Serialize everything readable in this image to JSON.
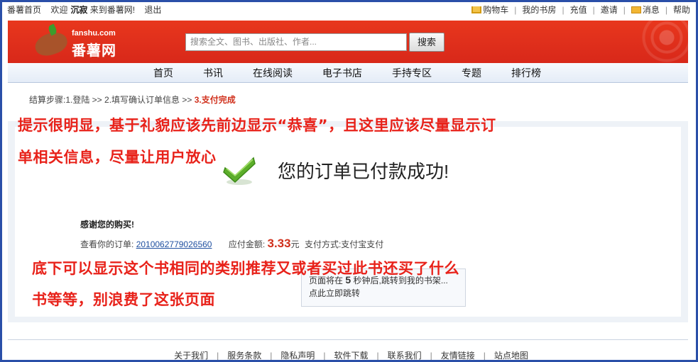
{
  "topbar": {
    "home": "番薯首页",
    "welcome_prefix": "欢迎",
    "username": "沉寂",
    "welcome_suffix": "来到番薯网!",
    "logout": "退出",
    "cart": "购物车",
    "my_books": "我的书房",
    "recharge": "充值",
    "invite": "邀请",
    "messages": "消息",
    "help": "帮助"
  },
  "header": {
    "logo_en": "fanshu.com",
    "logo_cn": "番薯网",
    "search_placeholder": "搜索全文、图书、出版社、作者...",
    "search_button": "搜索"
  },
  "nav": {
    "items": [
      "首页",
      "书讯",
      "在线阅读",
      "电子书店",
      "手持专区",
      "专题",
      "排行榜"
    ]
  },
  "steps": {
    "prefix": "结算步骤:1.登陆 >> 2.填写确认订单信息 >> ",
    "current": "3.支付完成"
  },
  "content": {
    "success_title": "您的订单已付款成功!",
    "thanks": "感谢您的购买!",
    "order_label": "查看你的订单:",
    "order_id": "2010062779026560",
    "amount_label": "应付金额:",
    "amount": "3.33",
    "amount_unit": "元",
    "payment_label": "支付方式:",
    "payment_method": "支付宝支付",
    "redirect_prefix": "页面将在",
    "redirect_seconds": "5",
    "redirect_suffix": "秒钟后,跳转到我的书架...",
    "redirect_link": "点此立即跳转"
  },
  "annotations": {
    "top_line1": "提示很明显，基于礼貌应该先前边显示“恭喜”，且这里应该尽量显示订",
    "top_line2": "单相关信息，尽量让用户放心",
    "bottom_line1": "底下可以显示这个书相同的类别推荐又或者买过此书还买了什么",
    "bottom_line2": "书等等，别浪费了这张页面"
  },
  "footer": {
    "links": [
      "关于我们",
      "服务条款",
      "隐私声明",
      "软件下载",
      "联系我们",
      "友情链接",
      "站点地图"
    ]
  },
  "colors": {
    "header_red": "#d8281a",
    "annotation_red": "#e8221a",
    "border_blue": "#2a4fa8",
    "link_blue": "#2050a0"
  }
}
